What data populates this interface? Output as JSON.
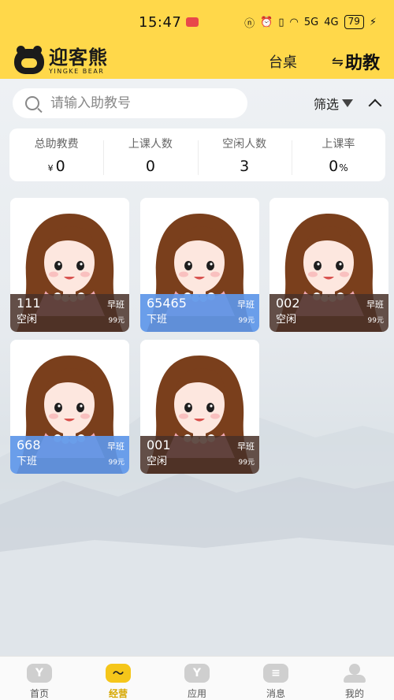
{
  "status_bar": {
    "time": "15:47",
    "network_5g": "5G",
    "network_4g": "4G",
    "battery": "79"
  },
  "header": {
    "logo_cn": "迎客熊",
    "logo_en": "YINGKE BEAR",
    "tab_table": "台桌",
    "tab_assistant": "助教",
    "swap_glyph": "⇋"
  },
  "search": {
    "placeholder": "请输入助教号",
    "value": "",
    "filter_label": "筛选"
  },
  "stats": [
    {
      "label": "总助教费",
      "prefix": "¥",
      "value": "0",
      "suffix": ""
    },
    {
      "label": "上课人数",
      "prefix": "",
      "value": "0",
      "suffix": ""
    },
    {
      "label": "空闲人数",
      "prefix": "",
      "value": "3",
      "suffix": ""
    },
    {
      "label": "上课率",
      "prefix": "",
      "value": "0",
      "suffix": "%"
    }
  ],
  "coaches": [
    {
      "number": "111",
      "shift": "早班",
      "status": "空闲",
      "price": "99元",
      "state": "idle"
    },
    {
      "number": "65465",
      "shift": "早班",
      "status": "下班",
      "price": "99元",
      "state": "off"
    },
    {
      "number": "002",
      "shift": "早班",
      "status": "空闲",
      "price": "99元",
      "state": "idle"
    },
    {
      "number": "668",
      "shift": "早班",
      "status": "下班",
      "price": "99元",
      "state": "off"
    },
    {
      "number": "001",
      "shift": "早班",
      "status": "空闲",
      "price": "99元",
      "state": "idle"
    }
  ],
  "colors": {
    "brand_yellow": "#ffd84a",
    "idle_overlay": "#483028",
    "off_overlay": "#5d96e8",
    "active_nav": "#f5c61a"
  },
  "bottom_nav": [
    {
      "label": "首页",
      "icon": "home-icon",
      "active": false
    },
    {
      "label": "经营",
      "icon": "business-icon",
      "active": true
    },
    {
      "label": "应用",
      "icon": "apps-icon",
      "active": false
    },
    {
      "label": "消息",
      "icon": "message-icon",
      "active": false
    },
    {
      "label": "我的",
      "icon": "profile-icon",
      "active": false
    }
  ]
}
